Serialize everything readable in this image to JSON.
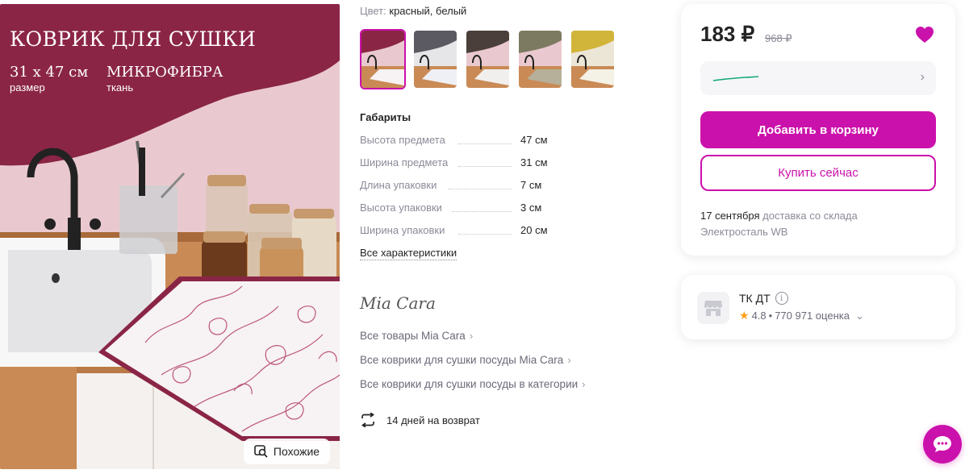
{
  "product_image": {
    "promo_title": "КОВРИК ДЛЯ СУШКИ",
    "size_value": "31 x 47 см",
    "size_caption": "размер",
    "fabric_value": "МИКРОФИБРА",
    "fabric_caption": "ткань",
    "similar_button": "Похожие",
    "accent_color": "#8a2546"
  },
  "color": {
    "label": "Цвет:",
    "value": "красный, белый"
  },
  "thumbnails": [
    {
      "accent": "#8a2546",
      "selected": true
    },
    {
      "accent": "#5b5a62",
      "selected": false
    },
    {
      "accent": "#4a3f3a",
      "selected": false
    },
    {
      "accent": "#7c7b62",
      "selected": false
    },
    {
      "accent": "#d1b43a",
      "selected": false
    }
  ],
  "dimensions": {
    "title": "Габариты",
    "rows": [
      {
        "label": "Высота предмета",
        "value": "47 см"
      },
      {
        "label": "Ширина предмета",
        "value": "31 см"
      },
      {
        "label": "Длина упаковки",
        "value": "7 см"
      },
      {
        "label": "Высота упаковки",
        "value": "3 см"
      },
      {
        "label": "Ширина упаковки",
        "value": "20 см"
      }
    ],
    "all_link": "Все характеристики"
  },
  "brand": {
    "logo_text": "Mia Cara",
    "links": [
      "Все товары Mia Cara",
      "Все коврики для сушки посуды Mia Cara",
      "Все коврики для сушки посуды в категории"
    ]
  },
  "returns": {
    "text": "14 дней на возврат"
  },
  "price_card": {
    "price": "183 ₽",
    "old_price": "968 ₽",
    "add_to_cart": "Добавить в корзину",
    "buy_now": "Купить сейчас",
    "delivery_date": "17 сентября",
    "delivery_rest_line1": "доставка со склада",
    "delivery_line2": "Электросталь WB",
    "brand_color": "#cb11ab"
  },
  "seller": {
    "name": "ТК ДТ",
    "rating": "4.8",
    "reviews": "770 971 оценка"
  }
}
